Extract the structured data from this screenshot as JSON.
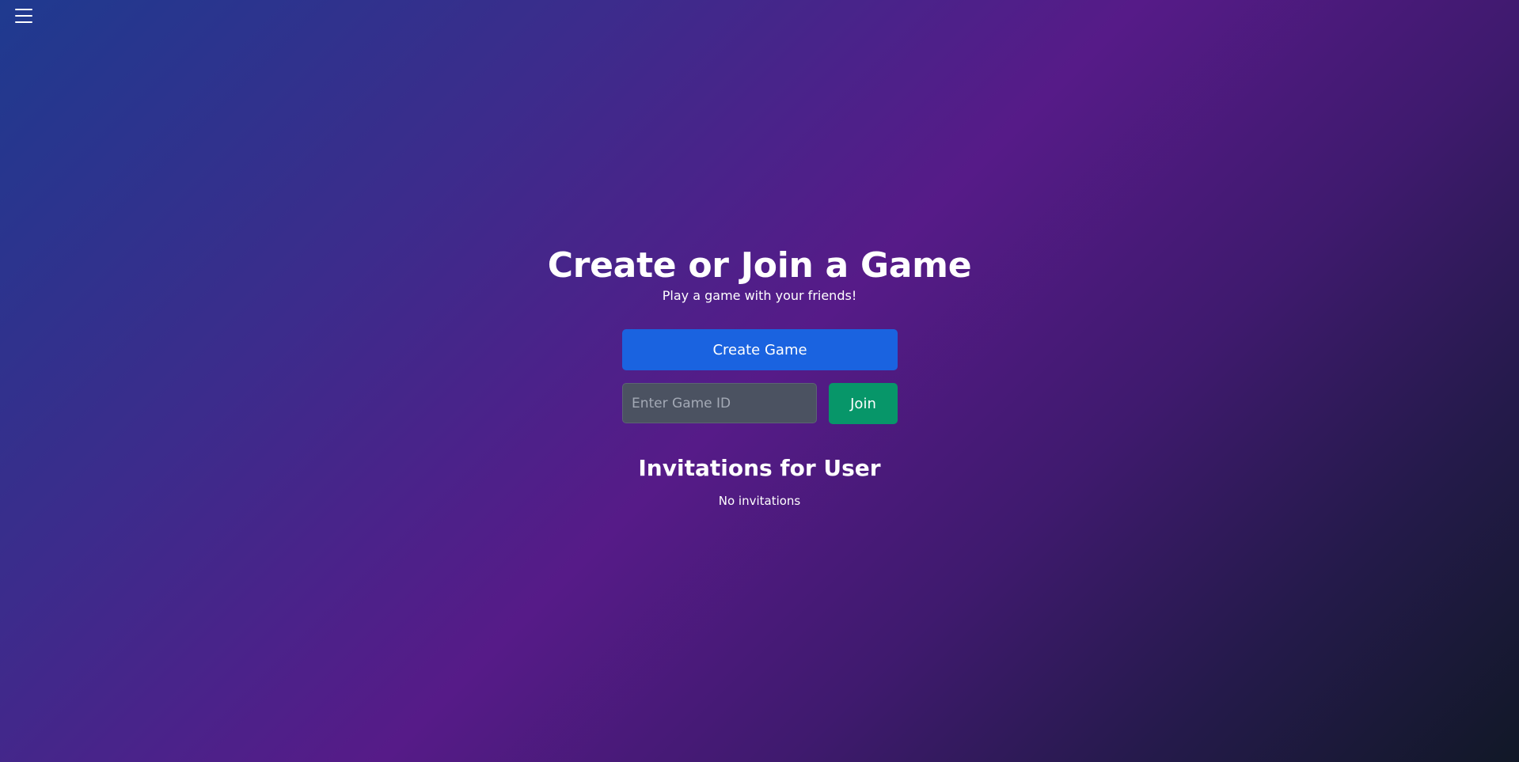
{
  "header": {
    "menu_icon": "hamburger-menu-icon"
  },
  "main": {
    "title": "Create or Join a Game",
    "subtitle": "Play a game with your friends!",
    "create_button_label": "Create Game",
    "game_id_input": {
      "value": "",
      "placeholder": "Enter Game ID"
    },
    "join_button_label": "Join"
  },
  "invitations": {
    "title": "Invitations for User",
    "empty_text": "No invitations"
  },
  "colors": {
    "create_button": "#1a63e0",
    "join_button": "#079669",
    "input_background": "#4b5261"
  }
}
